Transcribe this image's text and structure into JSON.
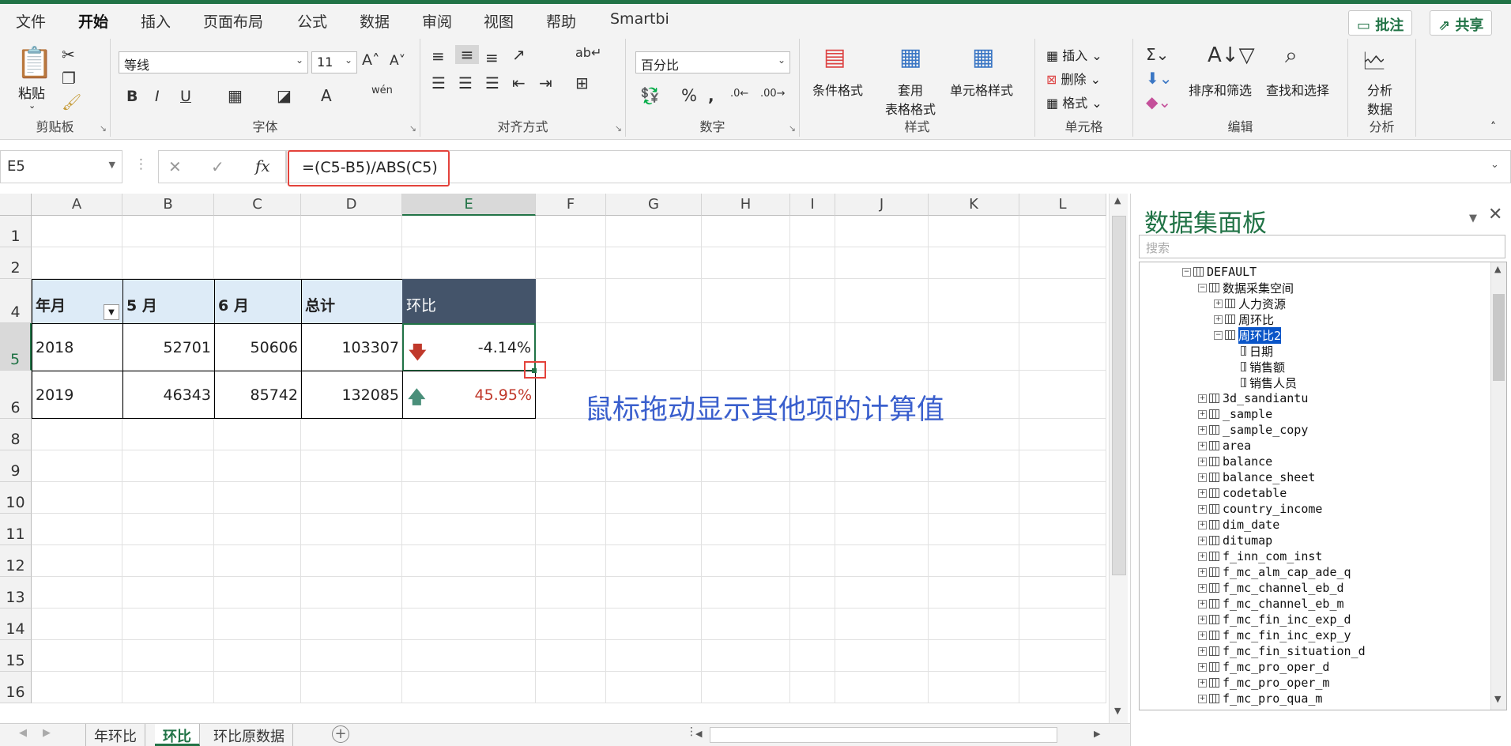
{
  "menu": {
    "tabs": [
      "文件",
      "开始",
      "插入",
      "页面布局",
      "公式",
      "数据",
      "审阅",
      "视图",
      "帮助",
      "Smartbi"
    ],
    "active": "开始",
    "comment_btn": "批注",
    "share_btn": "共享"
  },
  "ribbon": {
    "clipboard": {
      "label": "剪贴板",
      "paste": "粘贴"
    },
    "font": {
      "label": "字体",
      "font_name": "等线",
      "font_size": "11"
    },
    "align": {
      "label": "对齐方式"
    },
    "number": {
      "label": "数字",
      "format": "百分比"
    },
    "styles": {
      "label": "样式",
      "cond_format": "条件格式",
      "table_format": "套用\n表格格式",
      "cell_styles": "单元格样式"
    },
    "cells": {
      "label": "单元格",
      "insert": "插入",
      "delete": "删除",
      "format": "格式"
    },
    "editing": {
      "label": "编辑",
      "sort_filter": "排序和筛选",
      "find_select": "查找和选择"
    },
    "analysis": {
      "label": "分析",
      "analyze_data": "分析\n数据"
    }
  },
  "formula_bar": {
    "name_box": "E5",
    "formula": "=(C5-B5)/ABS(C5)"
  },
  "sheet": {
    "columns": [
      "A",
      "B",
      "C",
      "D",
      "E",
      "F",
      "G",
      "H",
      "I",
      "J",
      "K",
      "L"
    ],
    "rows": [
      "1",
      "2",
      "4",
      "5",
      "6",
      "8",
      "9",
      "10",
      "11",
      "12",
      "13",
      "14",
      "15",
      "16"
    ],
    "headers": [
      "年月",
      "5 月",
      "6 月",
      "总计",
      "环比"
    ],
    "data": [
      {
        "year": "2018",
        "may": "52701",
        "jun": "50606",
        "total": "103307",
        "ratio": "-4.14%"
      },
      {
        "year": "2019",
        "may": "46343",
        "jun": "85742",
        "total": "132085",
        "ratio": "45.95%"
      }
    ],
    "annotation": "鼠标拖动显示其他项的计算值"
  },
  "sheet_tabs": [
    "年环比",
    "环比",
    "环比原数据"
  ],
  "active_sheet": "环比",
  "panel": {
    "title": "数据集面板",
    "search_placeholder": "搜索",
    "tree": [
      "DEFAULT",
      "数据采集空间",
      "人力资源",
      "周环比",
      "周环比2",
      "日期",
      "销售额",
      "销售人员",
      "3d_sandiantu",
      "_sample",
      "_sample_copy",
      "area",
      "balance",
      "balance_sheet",
      "codetable",
      "country_income",
      "dim_date",
      "ditumap",
      "f_inn_com_inst",
      "f_mc_alm_cap_ade_q",
      "f_mc_channel_eb_d",
      "f_mc_channel_eb_m",
      "f_mc_fin_inc_exp_d",
      "f_mc_fin_inc_exp_y",
      "f_mc_fin_situation_d",
      "f_mc_pro_oper_d",
      "f_mc_pro_oper_m",
      "f_mc_pro_qua_m"
    ]
  },
  "colors": {
    "accent": "#217346",
    "header_dark": "#44546a",
    "header_light": "#ddebf7",
    "down": "#c0392b",
    "up": "#4a8f7a",
    "annotation": "#3a5fcd",
    "highlight": "#e3423b"
  }
}
